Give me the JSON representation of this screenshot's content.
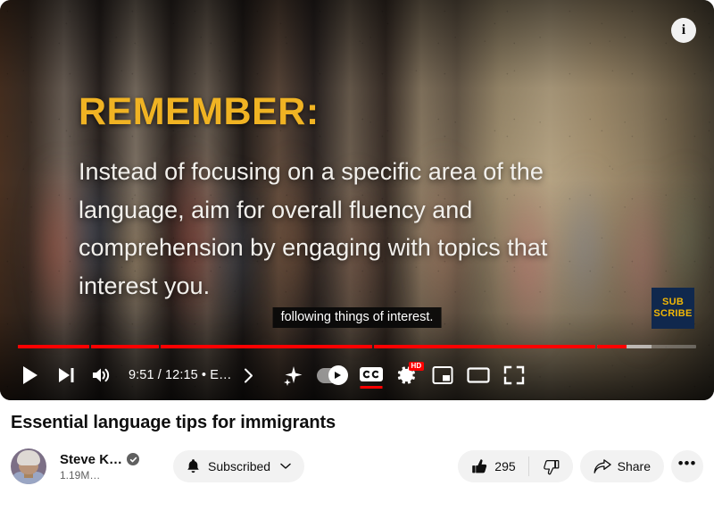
{
  "player": {
    "info_button_label": "i",
    "overlay": {
      "heading": "REMEMBER:",
      "body": "Instead of focusing on a specific area of the language, aim for overall fluency and comprehension by engaging with topics that interest you."
    },
    "caption_text": "following things of interest.",
    "subscribe_watermark": {
      "line1": "SUB",
      "line2": "SCRIBE"
    },
    "progress": {
      "current_time": "9:51",
      "duration": "12:15",
      "played_percent": 78,
      "buffered_percent": 83,
      "chapters": [
        {
          "width_percent": 10.6,
          "fill_percent": 100
        },
        {
          "width_percent": 10.2,
          "fill_percent": 100
        },
        {
          "width_percent": 31.4,
          "fill_percent": 100
        },
        {
          "width_percent": 33.0,
          "fill_percent": 100
        },
        {
          "width_percent": 14.8,
          "fill_percent": 30,
          "buffer_percent": 55
        }
      ]
    },
    "controls": {
      "play_label": "play-button",
      "next_label": "next-video-button",
      "volume_label": "volume-button",
      "time_display": "9:51 / 12:15 • E…",
      "chapter_chevron": "›",
      "sparkle_label": "ai-sparkle-button",
      "autoplay_label": "autoplay-toggle",
      "autoplay_state": "on",
      "captions_label": "CC",
      "captions_active": true,
      "settings_label": "settings-button",
      "quality_badge": "HD",
      "miniplayer_label": "miniplayer-button",
      "theater_label": "theater-mode-button",
      "fullscreen_label": "fullscreen-button"
    }
  },
  "meta": {
    "title": "Essential language tips for immigrants",
    "channel": {
      "name": "Steve K…",
      "verified": true,
      "subscribers": "1.19M…"
    },
    "subscribe": {
      "label": "Subscribed",
      "chevron": "⌄",
      "bell_icon": "bell-icon"
    },
    "actions": {
      "like_count": "295",
      "dislike_label": "",
      "share_label": "Share",
      "more_label": "•••"
    }
  },
  "colors": {
    "accent_red": "#ff0000",
    "overlay_heading": "#f0b323",
    "watermark_bg": "#10284d",
    "watermark_text": "#f2b705",
    "pill_bg": "#f2f2f2",
    "text_primary": "#0f0f0f",
    "text_secondary": "#606060"
  }
}
